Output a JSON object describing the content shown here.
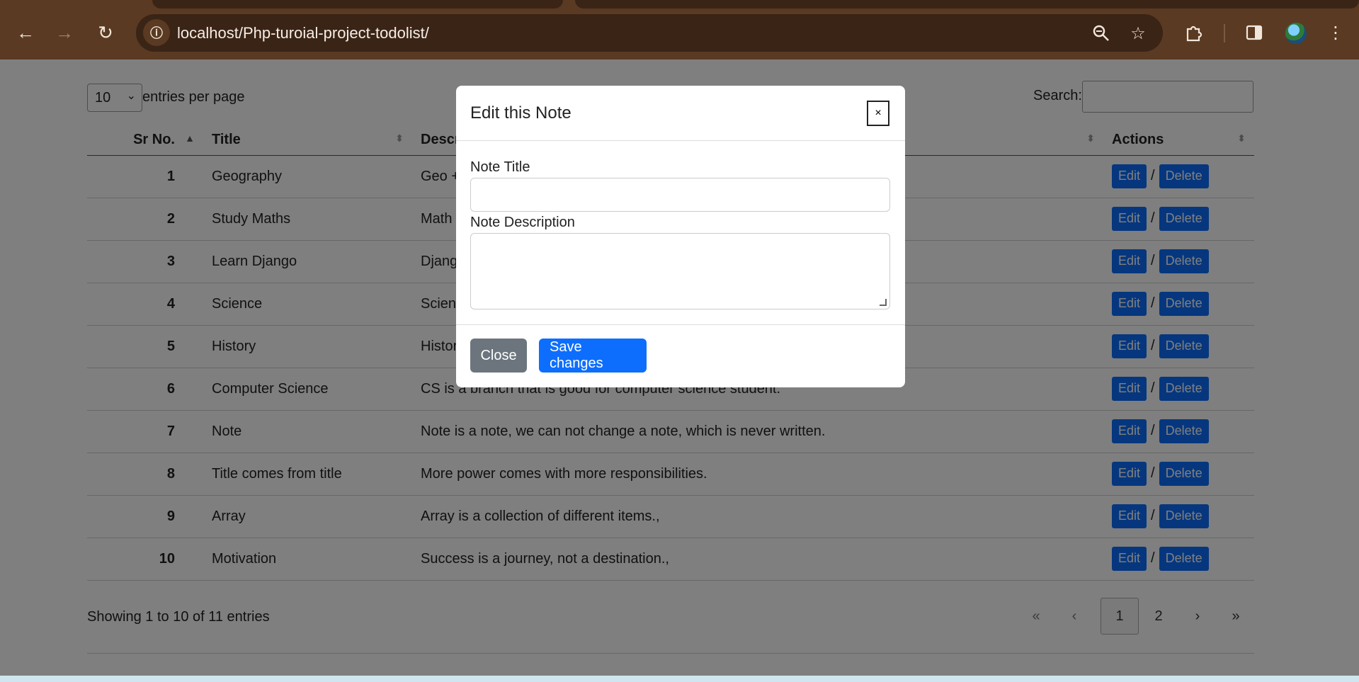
{
  "browser": {
    "url": "localhost/Php-turoial-project-todolist/",
    "icons": [
      "back-icon",
      "forward-icon",
      "reload-icon",
      "site-info-icon",
      "zoom-icon",
      "bookmark-star-icon",
      "extensions-icon",
      "side-panel-icon",
      "profile-avatar",
      "menu-icon"
    ]
  },
  "datatable": {
    "length_value": "10",
    "length_label": "entries per page",
    "search_label": "Search:",
    "search_value": "",
    "columns": [
      "Sr No.",
      "Title",
      "Description",
      "Actions"
    ],
    "rows": [
      {
        "num": "1",
        "title": "Geography",
        "description": "Geo + Graphy"
      },
      {
        "num": "2",
        "title": "Study Maths",
        "description": "Math is fun"
      },
      {
        "num": "3",
        "title": "Learn Django",
        "description": "Django framework"
      },
      {
        "num": "4",
        "title": "Science",
        "description": "Science is"
      },
      {
        "num": "5",
        "title": "History",
        "description": "History of"
      },
      {
        "num": "6",
        "title": "Computer Science",
        "description": "CS is a branch that is good for computer science student."
      },
      {
        "num": "7",
        "title": "Note",
        "description": "Note is a note, we can not change a note, which is never written."
      },
      {
        "num": "8",
        "title": "Title comes from title",
        "description": "More power comes with more responsibilities."
      },
      {
        "num": "9",
        "title": "Array",
        "description": "Array is a collection of different items.,"
      },
      {
        "num": "10",
        "title": "Motivation",
        "description": "Success is a journey, not a destination.,"
      }
    ],
    "edit_label": "Edit",
    "slash": "/",
    "delete_label": "Delete",
    "info": "Showing 1 to 10 of 11 entries",
    "pagination": {
      "first": "«",
      "prev": "‹",
      "pages": [
        "1",
        "2"
      ],
      "current": "1",
      "next": "›",
      "last": "»"
    }
  },
  "modal": {
    "title": "Edit this Note",
    "close_x": "×",
    "title_label": "Note Title",
    "title_value": "",
    "description_label": "Note Description",
    "description_value": "",
    "close_button": "Close",
    "save_button": "Save changes"
  },
  "colors": {
    "primary": "#0d6efd",
    "secondary": "#6c757d",
    "chrome": "#5a3a22",
    "omnibox": "#3a2416"
  }
}
